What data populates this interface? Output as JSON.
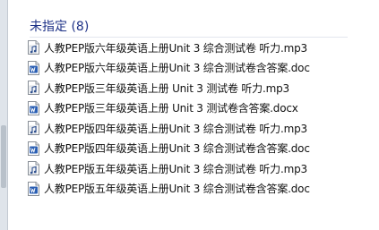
{
  "group": {
    "title": "未指定 (8)"
  },
  "files": [
    {
      "name": "人教PEP版六年级英语上册Unit 3 综合测试卷 听力.mp3",
      "icon": "mp3-file-icon"
    },
    {
      "name": "人教PEP版六年级英语上册Unit 3 综合测试卷含答案.doc",
      "icon": "doc-file-icon"
    },
    {
      "name": "人教PEP版三年级英语上册 Unit 3 测试卷 听力.mp3",
      "icon": "mp3-file-icon"
    },
    {
      "name": "人教PEP版三年级英语上册 Unit 3 测试卷含答案.docx",
      "icon": "doc-file-icon"
    },
    {
      "name": "人教PEP版四年级英语上册Unit 3 综合测试卷 听力.mp3",
      "icon": "mp3-file-icon"
    },
    {
      "name": "人教PEP版四年级英语上册Unit 3 综合测试卷含答案.doc",
      "icon": "doc-file-icon"
    },
    {
      "name": "人教PEP版五年级英语上册Unit 3 综合测试卷 听力.mp3",
      "icon": "mp3-file-icon"
    },
    {
      "name": "人教PEP版五年级英语上册Unit 3 综合测试卷含答案.doc",
      "icon": "doc-file-icon"
    }
  ],
  "colors": {
    "group_title": "#1e3287",
    "doc_icon": "#2b5fb3",
    "file_text": "#111111"
  }
}
